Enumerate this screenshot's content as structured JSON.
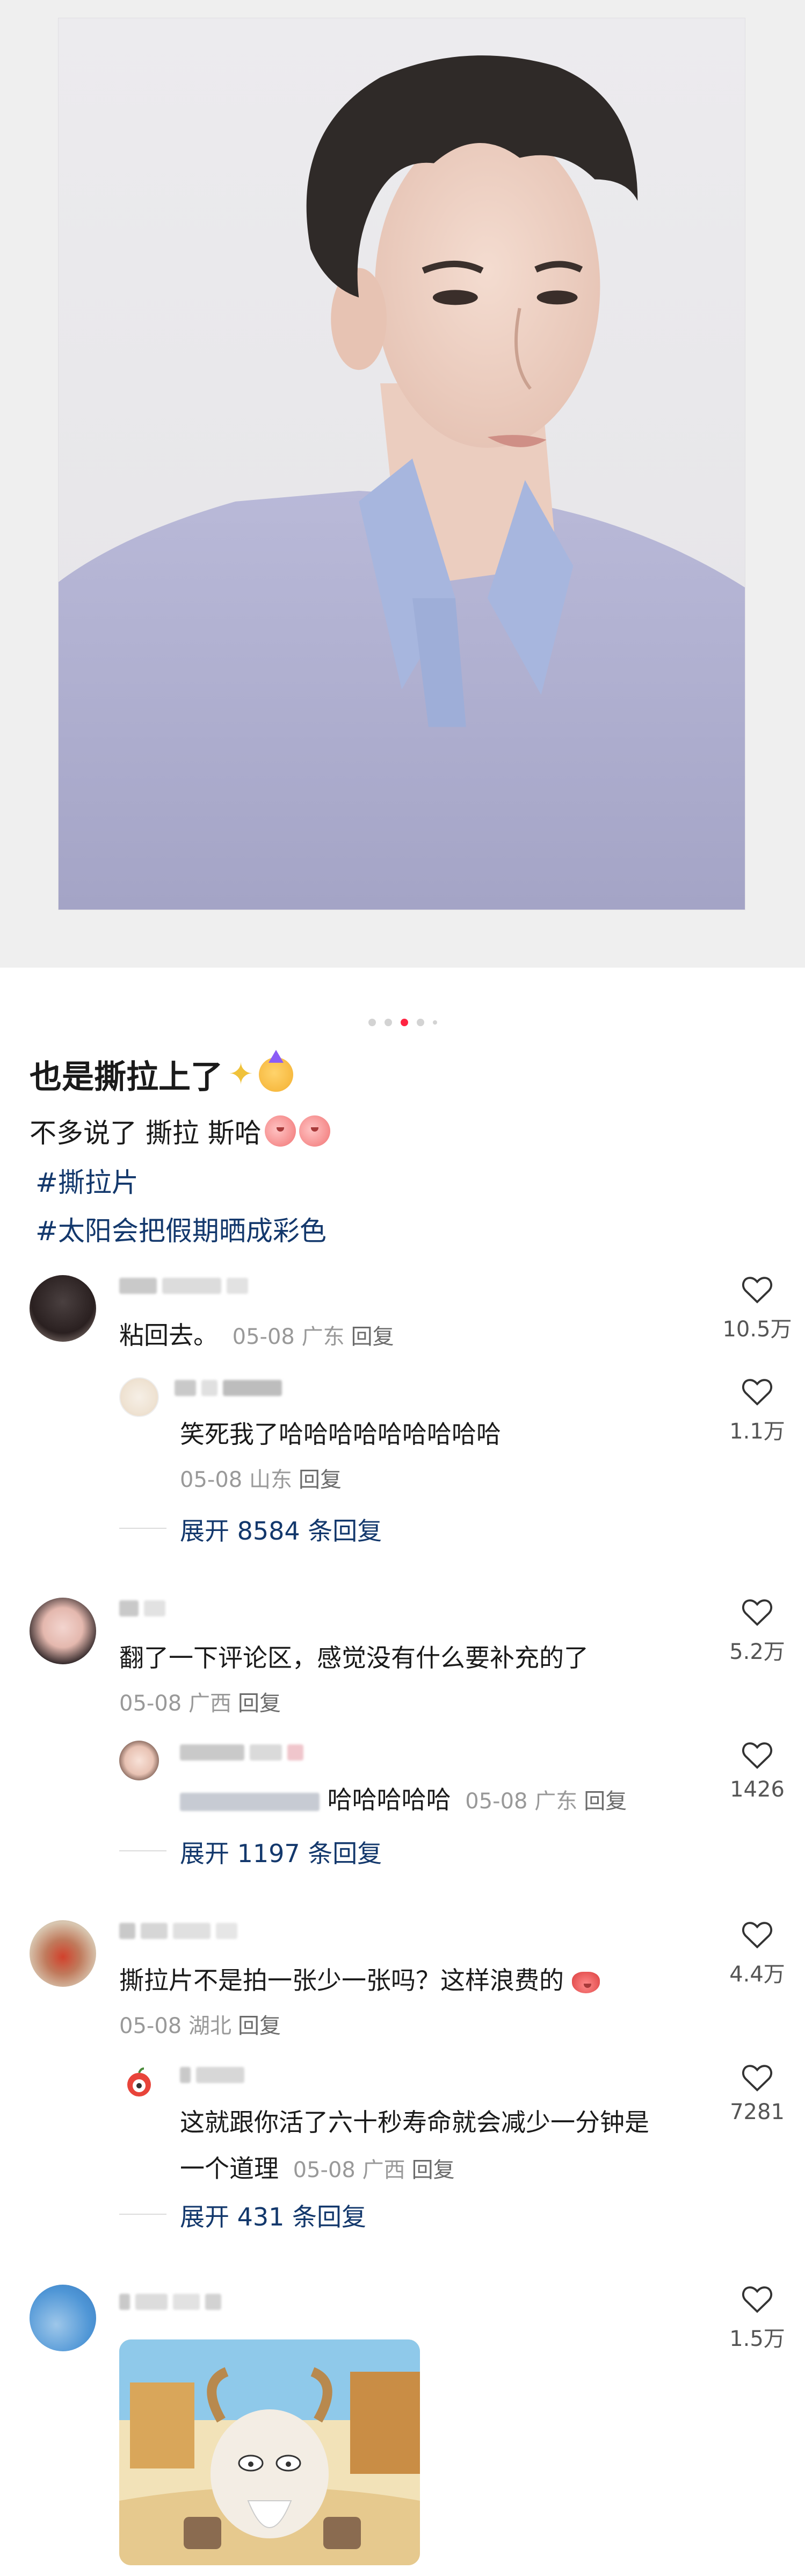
{
  "post": {
    "title": "也是撕拉上了",
    "body": "不多说了 撕拉 斯哈",
    "hashtags": [
      "#撕拉片",
      "#太阳会把假期晒成彩色"
    ],
    "carousel": {
      "count": 5,
      "active_index": 2
    }
  },
  "comments": [
    {
      "text": "粘回去。",
      "meta_date": "05-08",
      "meta_location": "广东",
      "reply_label": "回复",
      "likes": "10.5万",
      "reply": {
        "text": "笑死我了哈哈哈哈哈哈哈哈哈",
        "meta_date": "05-08",
        "meta_location": "山东",
        "reply_label": "回复",
        "likes": "1.1万"
      },
      "expand": "展开 8584 条回复"
    },
    {
      "text": "翻了一下评论区，感觉没有什么要补充的了",
      "meta_date": "05-08",
      "meta_location": "广西",
      "reply_label": "回复",
      "likes": "5.2万",
      "reply": {
        "text": "哈哈哈哈哈",
        "meta_date": "05-08",
        "meta_location": "广东",
        "reply_label": "回复",
        "likes": "1426"
      },
      "expand": "展开 1197 条回复"
    },
    {
      "text": "撕拉片不是拍一张少一张吗？这样浪费的",
      "meta_date": "05-08",
      "meta_location": "湖北",
      "reply_label": "回复",
      "likes": "4.4万",
      "reply": {
        "text_line1": "这就跟你活了六十秒寿命就会减少一分钟是",
        "text_line2": "一个道理",
        "meta_date": "05-08",
        "meta_location": "广西",
        "reply_label": "回复",
        "likes": "7281"
      },
      "expand": "展开 431 条回复"
    },
    {
      "likes": "1.5万"
    }
  ],
  "colors": {
    "accent_dot": "#ff2442",
    "hashtag": "#13386c",
    "meta_gray": "#999999"
  },
  "icons": {
    "like": "heart-outline-icon"
  }
}
